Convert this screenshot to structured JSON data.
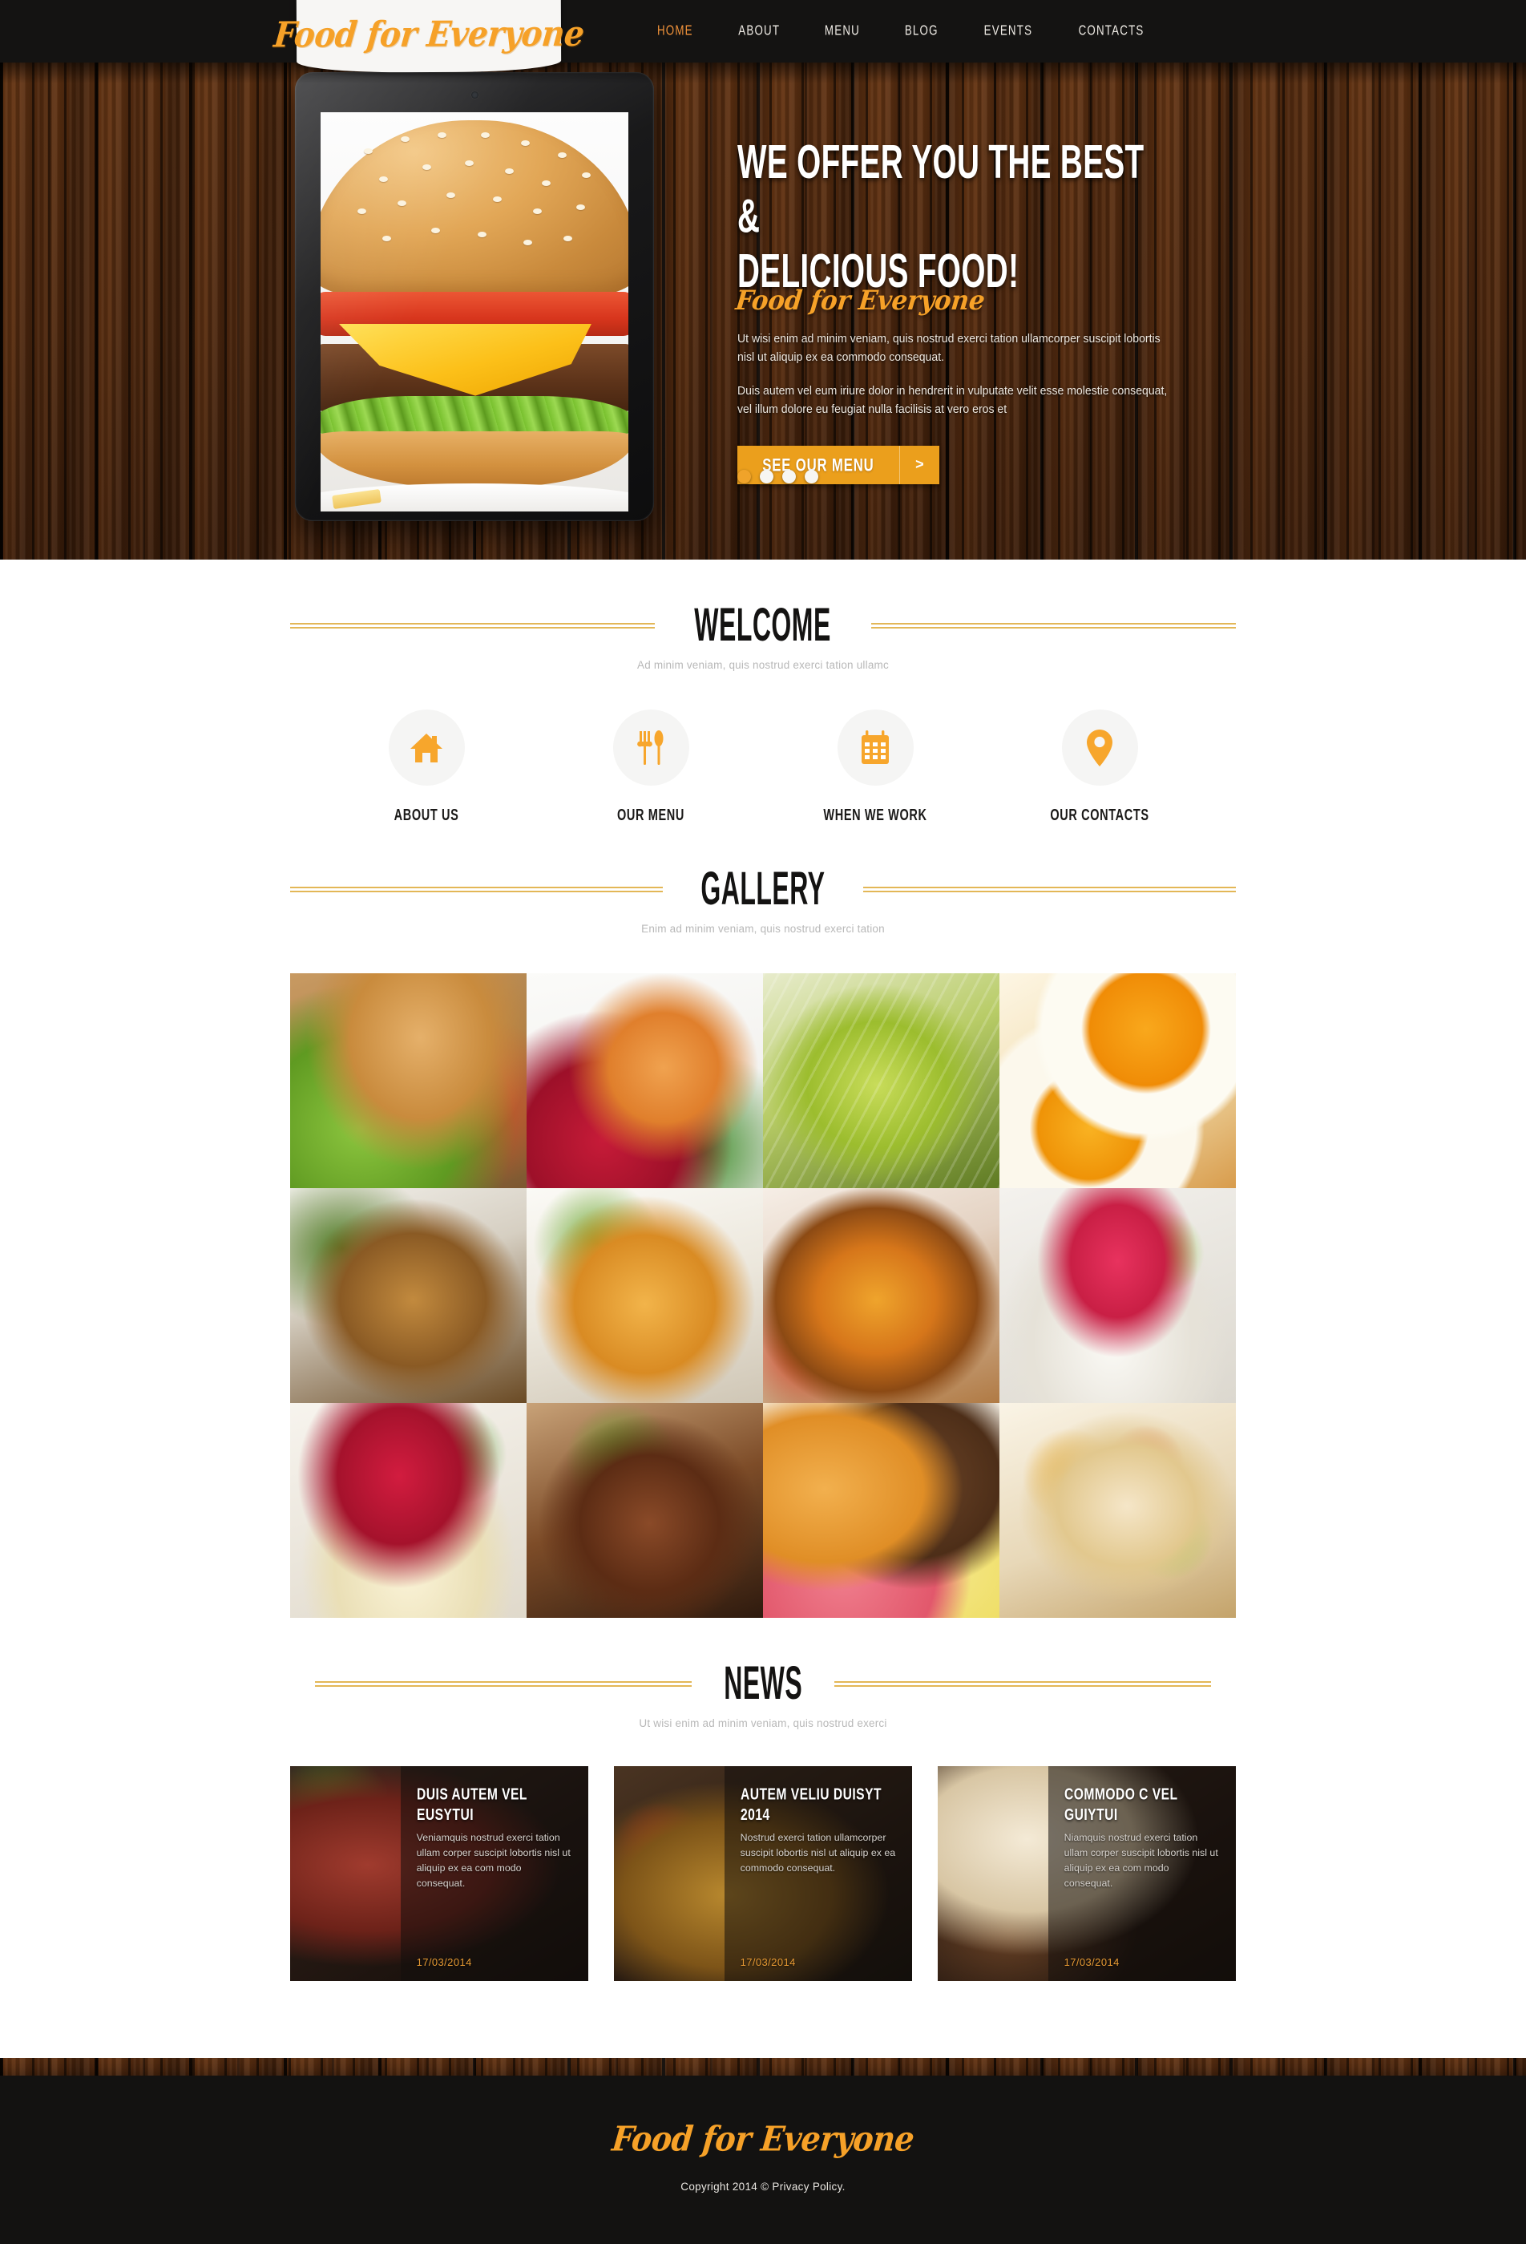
{
  "brand": {
    "name": "Food for Everyone",
    "accent_color": "#f6a128",
    "dark_color": "#141312",
    "rule_color": "#e3b757"
  },
  "nav": {
    "items": [
      {
        "label": "HOME",
        "active": true
      },
      {
        "label": "ABOUT",
        "active": false
      },
      {
        "label": "MENU",
        "active": false
      },
      {
        "label": "BLOG",
        "active": false
      },
      {
        "label": "EVENTS",
        "active": false
      },
      {
        "label": "CONTACTS",
        "active": false
      }
    ]
  },
  "hero": {
    "heading_line1": "WE OFFER YOU THE BEST &",
    "heading_line2": "DELICIOUS FOOD!",
    "script_line": "Food for Everyone",
    "paragraph1": "Ut wisi enim ad minim veniam, quis nostrud exerci tation ullamcorper suscipit lobortis nisl ut aliquip ex ea commodo consequat.",
    "paragraph2": "Duis autem vel eum iriure dolor in hendrerit in vulputate velit esse molestie consequat, vel illum dolore eu feugiat nulla facilisis at vero eros et",
    "cta_label": "SEE OUR MENU",
    "cta_arrow": ">",
    "slides": [
      {
        "active": true
      },
      {
        "active": false
      },
      {
        "active": false
      },
      {
        "active": false
      }
    ],
    "device_image": "cheeseburger-photo"
  },
  "welcome": {
    "title": "WELCOME",
    "subtitle": "Ad minim veniam, quis nostrud exerci tation ullamc",
    "features": [
      {
        "label": "ABOUT US",
        "icon": "home-icon"
      },
      {
        "label": "OUR MENU",
        "icon": "cutlery-icon"
      },
      {
        "label": "WHEN WE WORK",
        "icon": "calendar-icon"
      },
      {
        "label": "OUR CONTACTS",
        "icon": "location-pin-icon"
      }
    ]
  },
  "gallery": {
    "title": "GALLERY",
    "subtitle": "Enim ad minim veniam, quis nostrud exerci tation",
    "tiles": [
      {
        "name": "cheeseburger-on-wood"
      },
      {
        "name": "tea-cup-with-raspberries"
      },
      {
        "name": "green-pasta-closeup"
      },
      {
        "name": "fried-eggs"
      },
      {
        "name": "glazed-pork-roll"
      },
      {
        "name": "caramelized-dessert-slice"
      },
      {
        "name": "roasted-vegetable-stack"
      },
      {
        "name": "tuna-sushi-rolls"
      },
      {
        "name": "strawberry-cheesecake"
      },
      {
        "name": "grilled-steak-with-herbs"
      },
      {
        "name": "french-macarons"
      },
      {
        "name": "chicken-vegetable-wrap"
      }
    ]
  },
  "news": {
    "title": "NEWS",
    "subtitle": "Ut wisi enim ad minim veniam, quis nostrud exerci",
    "cards": [
      {
        "title": "DUIS AUTEM VEL EUSYTUI",
        "text": "Veniamquis nostrud exerci tation ullam corper suscipit lobortis nisl ut aliquip ex ea com modo consequat.",
        "date": "17/03/2014",
        "image": "sliced-steak-on-dark-plate"
      },
      {
        "title": "AUTEM VELIU DUISYT 2014",
        "text": "Nostrud exerci tation ullamcorper suscipit lobortis nisl ut aliquip ex ea commodo consequat.",
        "date": "17/03/2014",
        "image": "beef-tacos"
      },
      {
        "title": "COMMODO C VEL GUIYTUI",
        "text": "Niamquis nostrud exerci tation ullam corper suscipit lobortis nisl ut aliquip ex ea com modo consequat.",
        "date": "17/03/2014",
        "image": "frosted-cupcakes"
      }
    ]
  },
  "footer": {
    "logo": "Food for Everyone",
    "copyright": "Copyright 2014 © Privacy Policy."
  }
}
